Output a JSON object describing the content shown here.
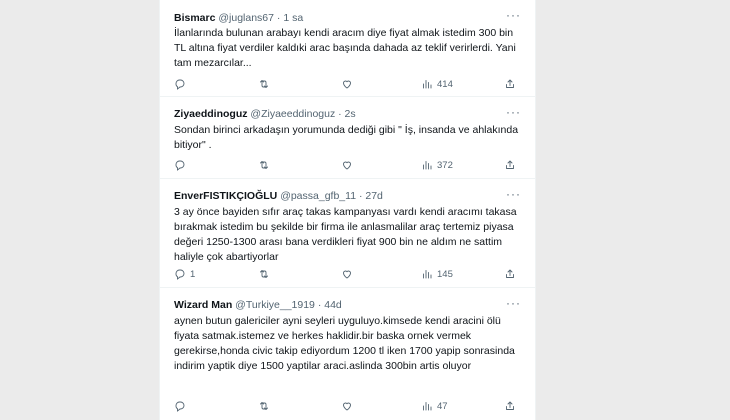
{
  "tweets": [
    {
      "name": "Bismarc",
      "handle": "@juglans67",
      "time": "· 1 sa",
      "text": "İlanlarında bulunan arabayı kendi aracım diye fiyat almak istedim 300 bin TL altına fiyat verdiler kaldıki arac başında dahada az teklif verirlerdi. Yani tam mezarcılar...",
      "reply_count": "",
      "views": "414"
    },
    {
      "name": "Ziyaeddinoguz",
      "handle": "@Ziyaeeddinoguz",
      "time": "· 2s",
      "text": "Sondan birinci arkadaşın yorumunda dediği gibi \" İş, insanda ve ahlakında bitiyor\" .",
      "reply_count": "",
      "views": "372"
    },
    {
      "name": "EnverFISTIKÇIOĞLU",
      "handle": "@passa_gfb_11",
      "time": "· 27d",
      "text": "3 ay önce bayiden sıfır araç takas kampanyası vardı kendi aracımı takasa bırakmak istedim bu şekilde bir firma ile anlasmalilar araç tertemiz piyasa değeri 1250-1300 arası bana verdikleri fiyat 900 bin ne aldım ne sattim haliyle çok abartiyorlar",
      "reply_count": "1",
      "views": "145"
    },
    {
      "name": "Wizard Man",
      "handle": "@Turkiye__1919",
      "time": "· 44d",
      "text": "aynen butun galericiler ayni seyleri uyguluyo.kimsede kendi aracini ölü fiyata satmak.istemez ve herkes haklidir.bir baska ornek vermek gerekirse,honda civic takip ediyordum 1200 tl iken 1700 yapip sonrasinda indirim yaptik diye 1500 yaptilar araci.aslinda 300bin artis oluyor",
      "reply_count": "",
      "views": "47"
    }
  ],
  "icons": {
    "more": "more-icon",
    "reply": "reply-icon",
    "retweet": "retweet-icon",
    "like": "like-icon",
    "views": "views-icon",
    "share": "share-icon"
  },
  "colors": {
    "text": "#0f1419",
    "secondary": "#536471",
    "background": "#ebebeb"
  }
}
